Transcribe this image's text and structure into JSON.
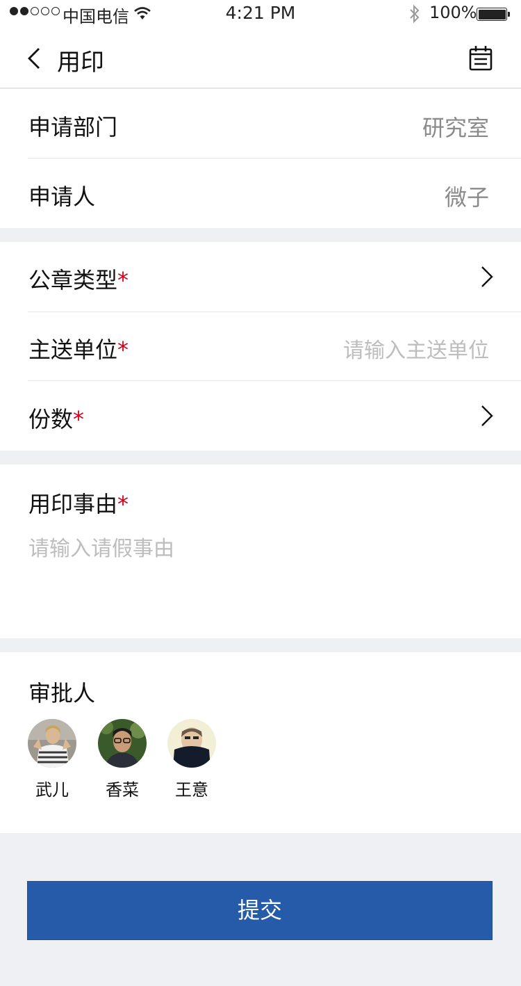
{
  "status_bar": {
    "carrier": "中国电信",
    "time": "4:21 PM",
    "battery": "100%"
  },
  "nav": {
    "title": "用印"
  },
  "info": {
    "department_label": "申请部门",
    "department_value": "研究室",
    "applicant_label": "申请人",
    "applicant_value": "微子"
  },
  "form": {
    "seal_type_label": "公章类型",
    "recipient_label": "主送单位",
    "recipient_placeholder": "请输入主送单位",
    "copies_label": "份数",
    "required_mark": "*"
  },
  "reason": {
    "label": "用印事由",
    "placeholder": "请输入请假事由"
  },
  "approvers": {
    "title": "审批人",
    "people": [
      {
        "name": "武儿"
      },
      {
        "name": "香菜"
      },
      {
        "name": "王意"
      }
    ]
  },
  "submit_label": "提交",
  "colors": {
    "primary": "#255ba8",
    "required": "#d0021b",
    "background": "#eff0f4"
  }
}
